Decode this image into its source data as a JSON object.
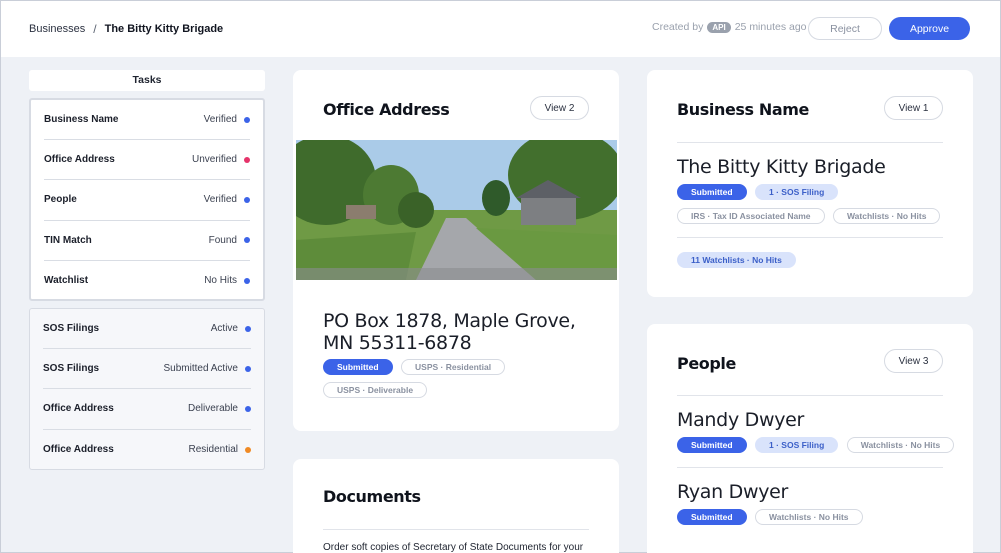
{
  "header": {
    "breadcrumb_root": "Businesses",
    "breadcrumb_sep": "/",
    "breadcrumb_current": "The Bitty Kitty Brigade",
    "created_prefix": "Created by",
    "created_badge": "API",
    "created_suffix": "25 minutes ago",
    "reject_label": "Reject",
    "approve_label": "Approve"
  },
  "tasks": {
    "title": "Tasks",
    "group1": [
      {
        "name": "Business Name",
        "status": "Verified",
        "color": "#3b63e8"
      },
      {
        "name": "Office Address",
        "status": "Unverified",
        "color": "#e5336a"
      },
      {
        "name": "People",
        "status": "Verified",
        "color": "#3b63e8"
      },
      {
        "name": "TIN Match",
        "status": "Found",
        "color": "#3b63e8"
      },
      {
        "name": "Watchlist",
        "status": "No Hits",
        "color": "#3b63e8"
      }
    ],
    "group2": [
      {
        "name": "SOS Filings",
        "status": "Active",
        "color": "#3b63e8"
      },
      {
        "name": "SOS Filings",
        "status": "Submitted Active",
        "color": "#3b63e8"
      },
      {
        "name": "Office Address",
        "status": "Deliverable",
        "color": "#3b63e8"
      },
      {
        "name": "Office Address",
        "status": "Residential",
        "color": "#f08a24"
      }
    ]
  },
  "office_address": {
    "title": "Office Address",
    "view_label": "View 2",
    "address_line1": "PO Box 1878, Maple Grove,",
    "address_line2": "MN 55311-6878",
    "pills": [
      "Submitted",
      "USPS · Residential",
      "USPS · Deliverable"
    ]
  },
  "documents": {
    "title": "Documents",
    "text": "Order soft copies of Secretary of State Documents for your"
  },
  "business_name": {
    "title": "Business Name",
    "view_label": "View 1",
    "name": "The Bitty Kitty Brigade",
    "pills_row1": [
      "Submitted",
      "1 · SOS Filing"
    ],
    "pills_row2": [
      "IRS · Tax ID Associated Name",
      "Watchlists · No Hits"
    ],
    "pills_row3": [
      "11 Watchlists · No Hits"
    ]
  },
  "people": {
    "title": "People",
    "view_label": "View 3",
    "person1": {
      "name": "Mandy Dwyer",
      "pills": [
        "Submitted",
        "1 · SOS Filing",
        "Watchlists · No Hits"
      ]
    },
    "person2": {
      "name": "Ryan Dwyer",
      "pills": [
        "Submitted",
        "Watchlists · No Hits"
      ]
    }
  },
  "colors": {
    "accent": "#3b63e8",
    "danger": "#e5336a",
    "warning": "#f08a24"
  }
}
